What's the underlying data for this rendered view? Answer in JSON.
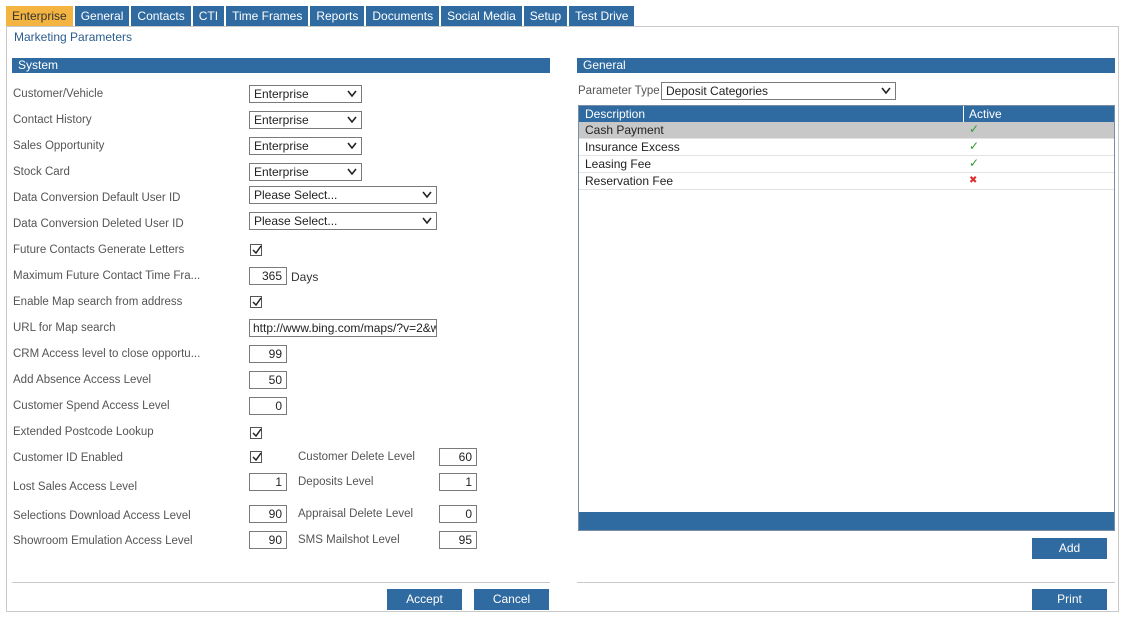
{
  "tabs": [
    "Enterprise",
    "General",
    "Contacts",
    "CTI",
    "Time Frames",
    "Reports",
    "Documents",
    "Social Media",
    "Setup",
    "Test Drive"
  ],
  "active_tab": "Enterprise",
  "page_title": "Marketing Parameters",
  "system": {
    "title": "System",
    "selects": [
      {
        "label": "Customer/Vehicle",
        "value": "Enterprise"
      },
      {
        "label": "Contact History",
        "value": "Enterprise"
      },
      {
        "label": "Sales Opportunity",
        "value": "Enterprise"
      },
      {
        "label": "Stock Card",
        "value": "Enterprise"
      },
      {
        "label": "Data Conversion Default User ID",
        "value": "Please Select..."
      },
      {
        "label": "Data Conversion Deleted User ID",
        "value": "Please Select..."
      }
    ],
    "future_contacts_label": "Future Contacts Generate Letters",
    "future_contacts_checked": true,
    "max_future_label": "Maximum Future Contact Time Fra...",
    "max_future_value": "365",
    "max_future_unit": "Days",
    "enable_map_label": "Enable Map search from address",
    "enable_map_checked": true,
    "url_map_label": "URL for Map search",
    "url_map_value": "http://www.bing.com/maps/?v=2&w",
    "crm_access_label": "CRM Access level to close opportu...",
    "crm_access_value": "99",
    "absence_label": "Add Absence Access Level",
    "absence_value": "50",
    "spend_label": "Customer Spend Access Level",
    "spend_value": "0",
    "postcode_label": "Extended Postcode Lookup",
    "postcode_checked": true,
    "custid_label": "Customer ID Enabled",
    "custid_checked": true,
    "cust_delete_label": "Customer Delete Level",
    "cust_delete_value": "60",
    "lost_sales_label": "Lost Sales Access Level",
    "lost_sales_value": "1",
    "deposits_label": "Deposits Level",
    "deposits_value": "1",
    "selections_label": "Selections Download Access Level",
    "selections_value": "90",
    "appraisal_label": "Appraisal Delete Level",
    "appraisal_value": "0",
    "showroom_label": "Showroom Emulation Access Level",
    "showroom_value": "90",
    "sms_label": "SMS Mailshot Level",
    "sms_value": "95",
    "accept_label": "Accept",
    "cancel_label": "Cancel"
  },
  "general": {
    "title": "General",
    "param_type_label": "Parameter Type",
    "param_type_value": "Deposit Categories",
    "grid_headers": [
      "Description",
      "Active"
    ],
    "rows": [
      {
        "description": "Cash Payment",
        "active": true
      },
      {
        "description": "Insurance Excess",
        "active": true
      },
      {
        "description": "Leasing Fee",
        "active": true
      },
      {
        "description": "Reservation Fee",
        "active": false
      }
    ],
    "add_label": "Add",
    "print_label": "Print"
  },
  "colors": {
    "accent": "#2f6aa0",
    "active_tab": "#f3b441",
    "check_green": "#2e9b2e",
    "cross_red": "#d9302c"
  }
}
